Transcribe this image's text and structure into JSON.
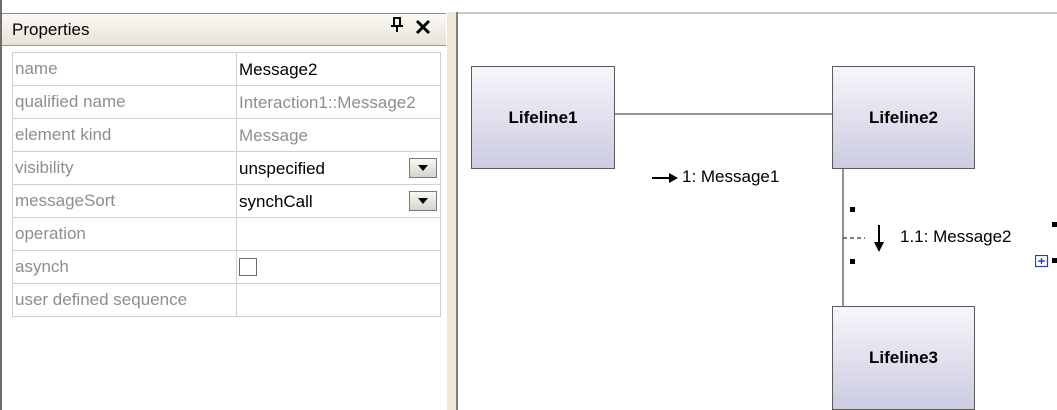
{
  "properties_panel": {
    "title": "Properties",
    "pin_icon": "pin-icon",
    "close_icon": "close-icon",
    "rows": [
      {
        "key": "name",
        "value": "Message2"
      },
      {
        "key": "qualified name",
        "value": "Interaction1::Message2"
      },
      {
        "key": "element kind",
        "value": "Message"
      },
      {
        "key": "visibility",
        "value": "unspecified"
      },
      {
        "key": "messageSort",
        "value": "synchCall"
      },
      {
        "key": "operation",
        "value": ""
      },
      {
        "key": "asynch",
        "value": ""
      },
      {
        "key": "user defined sequence",
        "value": ""
      }
    ],
    "asynch_checked": false
  },
  "diagram": {
    "lifelines": [
      "Lifeline1",
      "Lifeline2",
      "Lifeline3"
    ],
    "messages": [
      "1: Message1",
      "1.1: Message2"
    ],
    "icons": {
      "arrow_right": "arrow-right-icon",
      "arrow_down": "arrow-down-icon",
      "expand": "expand-icon"
    }
  },
  "colors": {
    "lifeline_top": "#f6f6fb",
    "lifeline_bottom": "#cbcbe2",
    "handle": "#000000",
    "expand_icon": "#1f3fbf"
  }
}
